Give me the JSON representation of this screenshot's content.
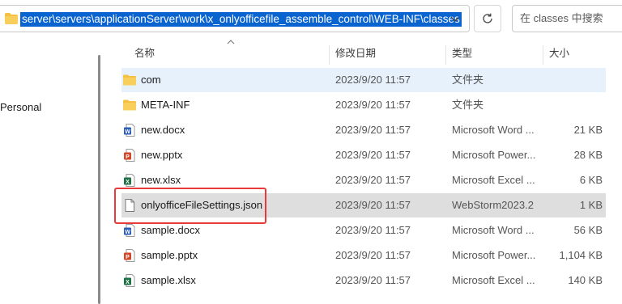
{
  "address_bar": {
    "path": "server\\servers\\applicationServer\\work\\x_onlyofficefile_assemble_control\\WEB-INF\\classes"
  },
  "search": {
    "placeholder": "在 classes 中搜索"
  },
  "nav": {
    "item_personal": "Personal"
  },
  "columns": {
    "name": "名称",
    "date": "修改日期",
    "type": "类型",
    "size": "大小"
  },
  "files": [
    {
      "name": "com",
      "date": "2023/9/20 11:57",
      "type": "文件夹",
      "size": "",
      "icon": "folder-icon"
    },
    {
      "name": "META-INF",
      "date": "2023/9/20 11:57",
      "type": "文件夹",
      "size": "",
      "icon": "folder-icon"
    },
    {
      "name": "new.docx",
      "date": "2023/9/20 11:57",
      "type": "Microsoft Word ...",
      "size": "21 KB",
      "icon": "word-doc-icon"
    },
    {
      "name": "new.pptx",
      "date": "2023/9/20 11:57",
      "type": "Microsoft Power...",
      "size": "28 KB",
      "icon": "powerpoint-doc-icon"
    },
    {
      "name": "new.xlsx",
      "date": "2023/9/20 11:57",
      "type": "Microsoft Excel ...",
      "size": "6 KB",
      "icon": "excel-doc-icon"
    },
    {
      "name": "onlyofficeFileSettings.json",
      "date": "2023/9/20 11:57",
      "type": "WebStorm2023.2",
      "size": "1 KB",
      "icon": "json-file-icon"
    },
    {
      "name": "sample.docx",
      "date": "2023/9/20 11:57",
      "type": "Microsoft Word ...",
      "size": "56 KB",
      "icon": "word-doc-icon"
    },
    {
      "name": "sample.pptx",
      "date": "2023/9/20 11:57",
      "type": "Microsoft Power...",
      "size": "1,104 KB",
      "icon": "powerpoint-doc-icon"
    },
    {
      "name": "sample.xlsx",
      "date": "2023/9/20 11:57",
      "type": "Microsoft Excel ...",
      "size": "140 KB",
      "icon": "excel-doc-icon"
    }
  ],
  "colors": {
    "selection_highlight": "#0a64d0",
    "row_selected": "#e6f1fb",
    "row_hover": "#dedede",
    "annotation_box": "#e83a3a",
    "folder": "#f5c043",
    "word": "#2b5cb8",
    "powerpoint": "#d24726",
    "excel": "#1e7145"
  }
}
